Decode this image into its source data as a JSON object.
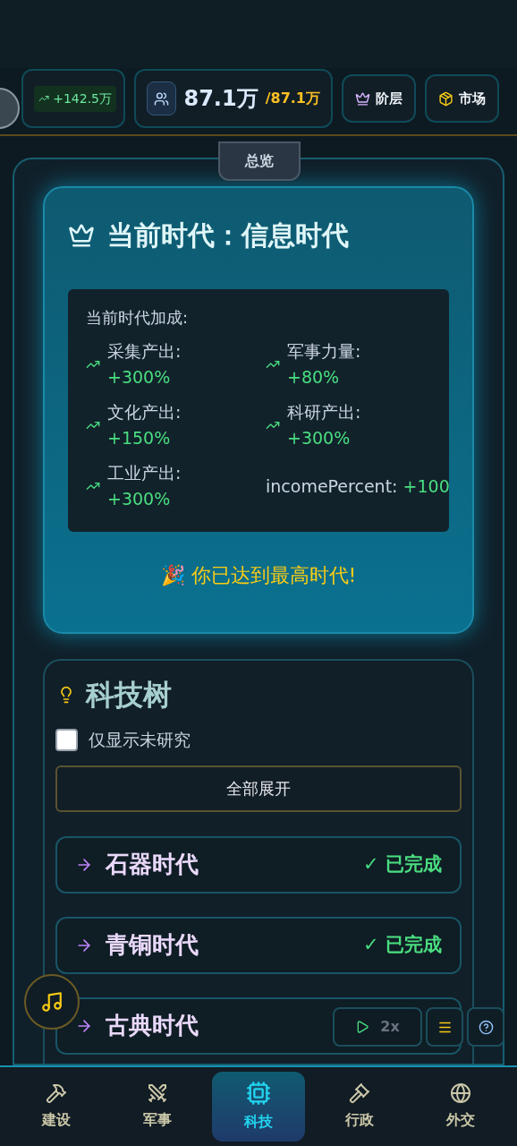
{
  "resources": {
    "income": {
      "value": "+142.5万"
    },
    "population": {
      "value": "87.1万",
      "max": "/87.1万"
    },
    "buttons": [
      {
        "label": "阶层",
        "kind": "strata"
      },
      {
        "label": "市场",
        "kind": "market"
      }
    ]
  },
  "overview_tab": {
    "label": "总览",
    "selected": true
  },
  "era_card": {
    "title": "当前时代：信息时代",
    "bonus_heading": "当前时代加成:",
    "bonuses": [
      {
        "kind": "trend",
        "label": "采集产出:",
        "value": "+300%"
      },
      {
        "kind": "trend",
        "label": "军事力量:",
        "value": "+80%"
      },
      {
        "kind": "trend",
        "label": "文化产出:",
        "value": "+150%"
      },
      {
        "kind": "trend",
        "label": "科研产出:",
        "value": "+300%"
      },
      {
        "kind": "trend",
        "label": "工业产出:",
        "value": "+300%"
      },
      {
        "kind": "plain",
        "label": "incomePercent:",
        "value": "+100"
      }
    ],
    "max_message": "🎉 你已达到最高时代!"
  },
  "tech_tree": {
    "title": "科技树",
    "filter": {
      "label": "仅显示未研究",
      "checked": false
    },
    "expand_button": "全部展开",
    "eras": [
      {
        "name": "石器时代",
        "status": "✓ 已完成"
      },
      {
        "name": "青铜时代",
        "status": "✓ 已完成"
      },
      {
        "name": "古典时代"
      }
    ]
  },
  "floating": {
    "speed": "2x"
  },
  "nav": [
    {
      "label": "建设",
      "kind": "build",
      "selected": false
    },
    {
      "label": "军事",
      "kind": "military",
      "selected": false
    },
    {
      "label": "科技",
      "kind": "tech",
      "selected": true
    },
    {
      "label": "行政",
      "kind": "admin",
      "selected": false
    },
    {
      "label": "外交",
      "kind": "diplomacy",
      "selected": false
    }
  ]
}
